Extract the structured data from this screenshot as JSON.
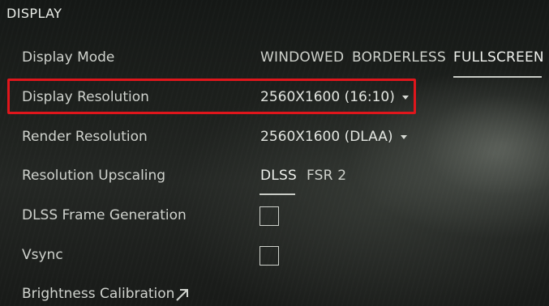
{
  "section": {
    "title": "DISPLAY"
  },
  "rows": {
    "display_mode": {
      "label": "Display Mode",
      "options": [
        "WINDOWED",
        "BORDERLESS",
        "FULLSCREEN"
      ],
      "selected": "FULLSCREEN"
    },
    "display_resolution": {
      "label": "Display Resolution",
      "value": "2560X1600 (16:10)"
    },
    "render_resolution": {
      "label": "Render Resolution",
      "value": "2560X1600 (DLAA)"
    },
    "resolution_upscaling": {
      "label": "Resolution Upscaling",
      "options": [
        "DLSS",
        "FSR 2"
      ],
      "selected": "DLSS"
    },
    "dlss_frame_generation": {
      "label": "DLSS Frame Generation",
      "checked": false
    },
    "vsync": {
      "label": "Vsync",
      "checked": false
    },
    "brightness_calibration": {
      "label": "Brightness Calibration",
      "icon": "external-arrow-icon"
    }
  },
  "colors": {
    "highlight": "#e0161c",
    "text": "#d0d3ce",
    "underline": "#c9ccc6"
  }
}
